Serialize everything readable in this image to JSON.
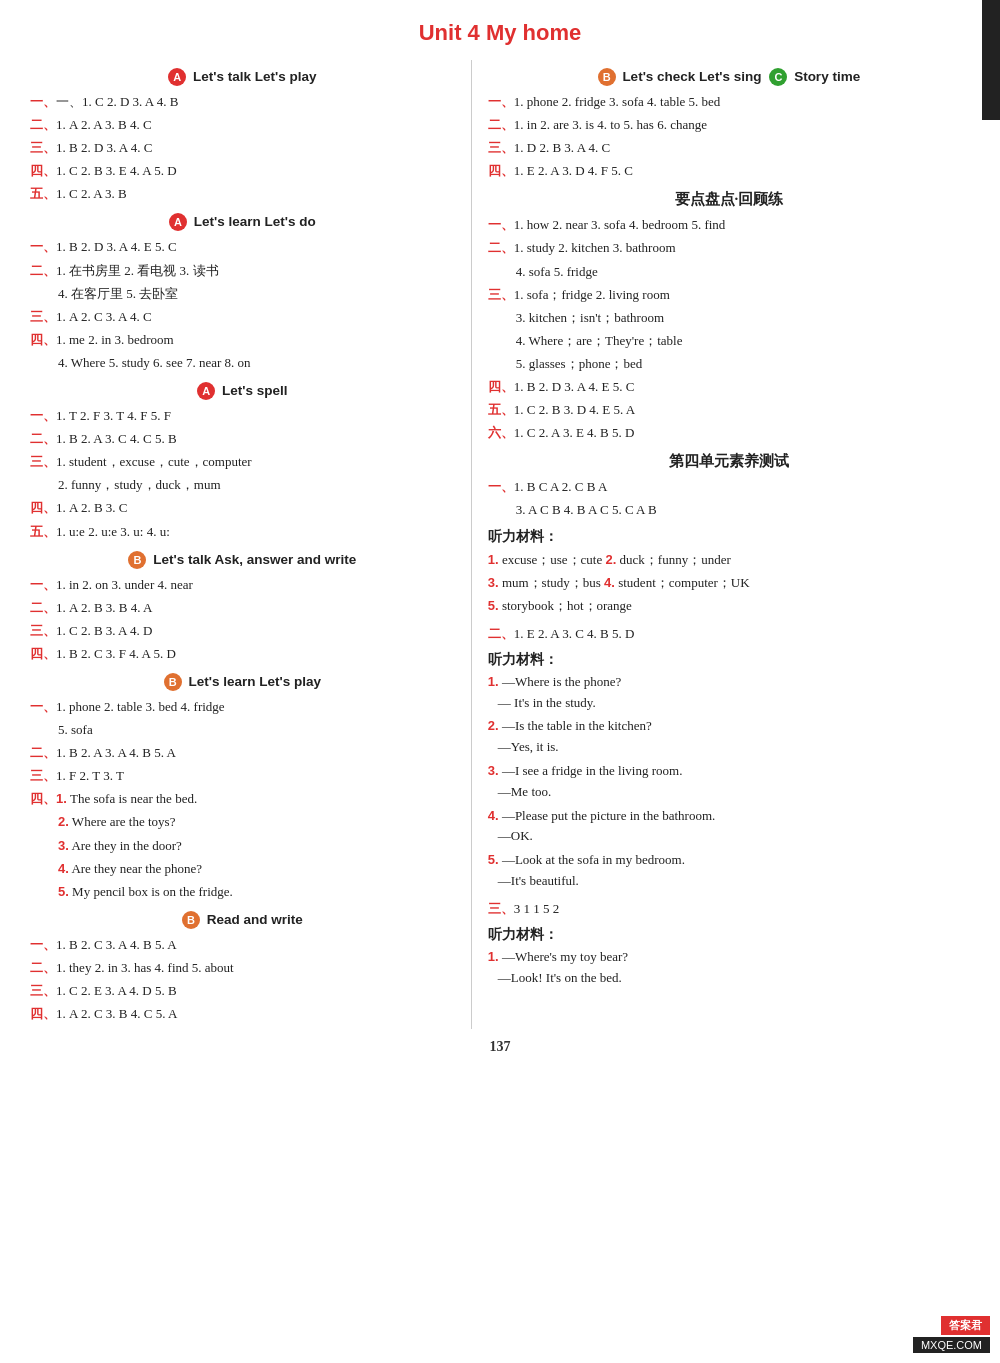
{
  "title": "Unit 4    My home",
  "left_col": {
    "sections": [
      {
        "id": "lets-talk-play",
        "icon": "A",
        "title": "Let's talk    Let's play",
        "rows": [
          "一、1. C  2. D  3. A  4. B",
          "二、1. A  2. A  3. B  4. C",
          "三、1. B  2. D  3. A  4. C",
          "四、1. C  2. B  3. E  4. A  5. D",
          "五、1. C  2. A  3. B"
        ]
      },
      {
        "id": "lets-learn-do",
        "icon": "A",
        "title": "Let's learn    Let's do",
        "rows": [
          "一、1. B  2. D  3. A  4. E  5. C",
          "二、1. 在书房里  2. 看电视  3. 读书",
          "    4. 在客厅里  5. 去卧室",
          "三、1. A  2. C  3. A  4. C",
          "四、1. me  2. in  3. bedroom",
          "    4. Where  5. study  6. see  7. near  8. on"
        ]
      },
      {
        "id": "lets-spell",
        "icon": "A",
        "title": "Let's spell",
        "rows": [
          "一、1. T  2. F  3. T  4. F  5. F",
          "二、1. B  2. A  3. C  4. C  5. B",
          "三、1. student，excuse，cute，computer",
          "    2. funny，study，duck，mum",
          "四、1. A  2. B  3. C",
          "五、1. u:e  2. u:e  3. u:  4. u:"
        ]
      },
      {
        "id": "lets-talk-ask",
        "icon": "B",
        "title": "Let's talk    Ask, answer and write",
        "rows": [
          "一、1. in  2. on  3. under  4. near",
          "二、1. A  2. B  3. B  4. A",
          "三、1. C  2. B  3. A  4. D",
          "四、1. B  2. C  3. F  4. A  5. D"
        ]
      },
      {
        "id": "lets-learn-play",
        "icon": "B",
        "title": "Let's learn    Let's play",
        "rows": [
          "一、1. phone  2. table  3. bed  4. fridge",
          "    5. sofa",
          "二、1. B  2. A  3. A  4. B  5. A",
          "三、1. F  2. T  3. T",
          "四、1. The sofa is near the bed.",
          "    2. Where are the toys?",
          "    3. Are they in the door?",
          "    4. Are they near the phone?",
          "    5. My pencil box is on the fridge."
        ]
      },
      {
        "id": "read-write",
        "icon": "B",
        "title": "Read and write",
        "rows": [
          "一、1. B  2. C  3. A  4. B  5. A",
          "二、1. they  2. in  3. has  4. find  5. about",
          "三、1. C  2. E  3. A  4. D  5. B",
          "四、1. A  2. C  3. B  4. C  5. A"
        ]
      }
    ]
  },
  "right_col": {
    "sections": [
      {
        "id": "lets-check-sing-story",
        "icons": [
          "B",
          "C"
        ],
        "title": "Let's check    Let's sing    Story time",
        "rows": [
          "一、1. phone  2. fridge  3. sofa  4. table  5. bed",
          "二、1. in  2. are  3. is  4. to  5. has  6. change",
          "三、1. D  2. B  3. A  4. C",
          "四、1. E  2. A  3. D  4. F  5. C"
        ]
      },
      {
        "id": "review",
        "header": "要点盘点·回顾练",
        "header_type": "chinese",
        "rows": [
          "一、1. how  2. near  3. sofa  4. bedroom  5. find",
          "二、1. study  2. kitchen  3. bathroom",
          "    4. sofa  5. fridge",
          "三、1. sofa；fridge  2. living room",
          "    3. kitchen；isn't；bathroom",
          "    4. Where；are；They're；table",
          "    5. glasses；phone；bed",
          "四、1. B  2. D  3. A  4. E  5. C",
          "五、1. C  2. B  3. D  4. E  5. A",
          "六、1. C  2. A  3. E  4. B  5. D"
        ]
      },
      {
        "id": "unit-test",
        "header": "第四单元素养测试",
        "header_type": "unit-test",
        "rows": [
          "一、1. B  C  A  2. C  B  A",
          "    3. A  C  B  4. B  A  C  5. C  A  B"
        ]
      },
      {
        "id": "listening1",
        "listening_header": "听力材料：",
        "rows": [
          "1. excuse；use；cute  2. duck；funny；under",
          "3. mum；study；bus  4. student；computer；UK",
          "5. storybook；hot；orange"
        ]
      },
      {
        "id": "er2",
        "rows": [
          "二、1. E  2. A  3. C  4. B  5. D"
        ]
      },
      {
        "id": "listening2",
        "listening_header": "听力材料：",
        "dialogues": [
          {
            "num": "1",
            "q": "—Where is the phone?",
            "a": "— It's in the study."
          },
          {
            "num": "2",
            "q": "—Is the table in the kitchen?",
            "a": "—Yes, it is."
          },
          {
            "num": "3",
            "q": "—I see a fridge in the living room.",
            "a": "—Me too."
          },
          {
            "num": "4",
            "q": "—Please put the picture in the bathroom.",
            "a": "—OK."
          },
          {
            "num": "5",
            "q": "—Look at the sofa in my bedroom.",
            "a": "—It's beautiful."
          }
        ]
      },
      {
        "id": "san3",
        "rows": [
          "三、3  1  1  5  2"
        ]
      },
      {
        "id": "listening3",
        "listening_header": "听力材料：",
        "dialogues": [
          {
            "num": "1",
            "q": "—Where's my toy bear?",
            "a": "—Look! It's on the bed."
          }
        ]
      }
    ]
  },
  "page_number": "137",
  "watermark": {
    "top": "答案君",
    "url": "MXQE.COM"
  }
}
